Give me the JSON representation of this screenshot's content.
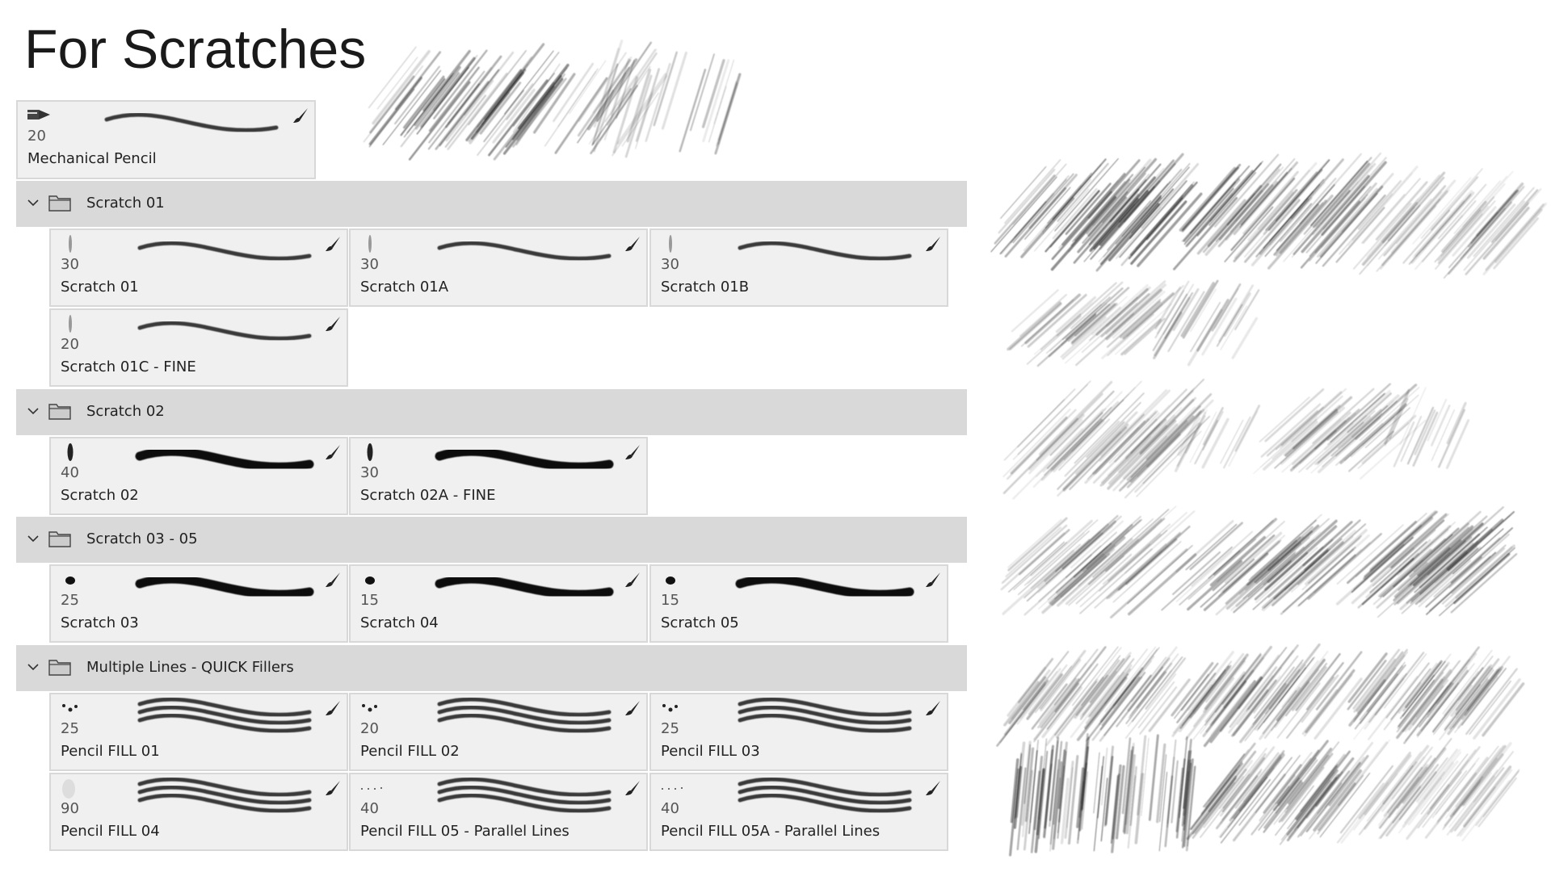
{
  "title": "For Scratches",
  "single_brush": {
    "size": "20",
    "name": "Mechanical Pencil",
    "tip": "pencil-tip"
  },
  "groups": [
    {
      "name": "Scratch 01",
      "expanded": true,
      "brushes": [
        {
          "size": "30",
          "name": "Scratch 01",
          "tip": "thin"
        },
        {
          "size": "30",
          "name": "Scratch 01A",
          "tip": "thin"
        },
        {
          "size": "30",
          "name": "Scratch 01B",
          "tip": "thin"
        },
        {
          "size": "20",
          "name": "Scratch 01C - FINE",
          "tip": "thin"
        }
      ]
    },
    {
      "name": "Scratch 02",
      "expanded": true,
      "brushes": [
        {
          "size": "40",
          "name": "Scratch 02",
          "tip": "dark"
        },
        {
          "size": "30",
          "name": "Scratch 02A - FINE",
          "tip": "dark"
        }
      ]
    },
    {
      "name": "Scratch 03 - 05",
      "expanded": true,
      "brushes": [
        {
          "size": "25",
          "name": "Scratch 03",
          "tip": "blob"
        },
        {
          "size": "15",
          "name": "Scratch 04",
          "tip": "blob"
        },
        {
          "size": "15",
          "name": "Scratch 05",
          "tip": "blob"
        }
      ]
    },
    {
      "name": "Multiple Lines - QUICK Fillers",
      "expanded": true,
      "brushes": [
        {
          "size": "25",
          "name": "Pencil FILL 01",
          "tip": "dots"
        },
        {
          "size": "20",
          "name": "Pencil FILL 02",
          "tip": "dots"
        },
        {
          "size": "25",
          "name": "Pencil FILL 03",
          "tip": "dots"
        },
        {
          "size": "90",
          "name": "Pencil FILL 04",
          "tip": "faint"
        },
        {
          "size": "40",
          "name": "Pencil FILL 05 - Parallel Lines",
          "tip": "dotline"
        },
        {
          "size": "40",
          "name": "Pencil FILL 05A - Parallel Lines",
          "tip": "dotline"
        }
      ]
    }
  ],
  "colors": {
    "card_bg": "#f0f0f0",
    "group_bg": "#d9d9d9",
    "border": "#d8d8d8"
  }
}
